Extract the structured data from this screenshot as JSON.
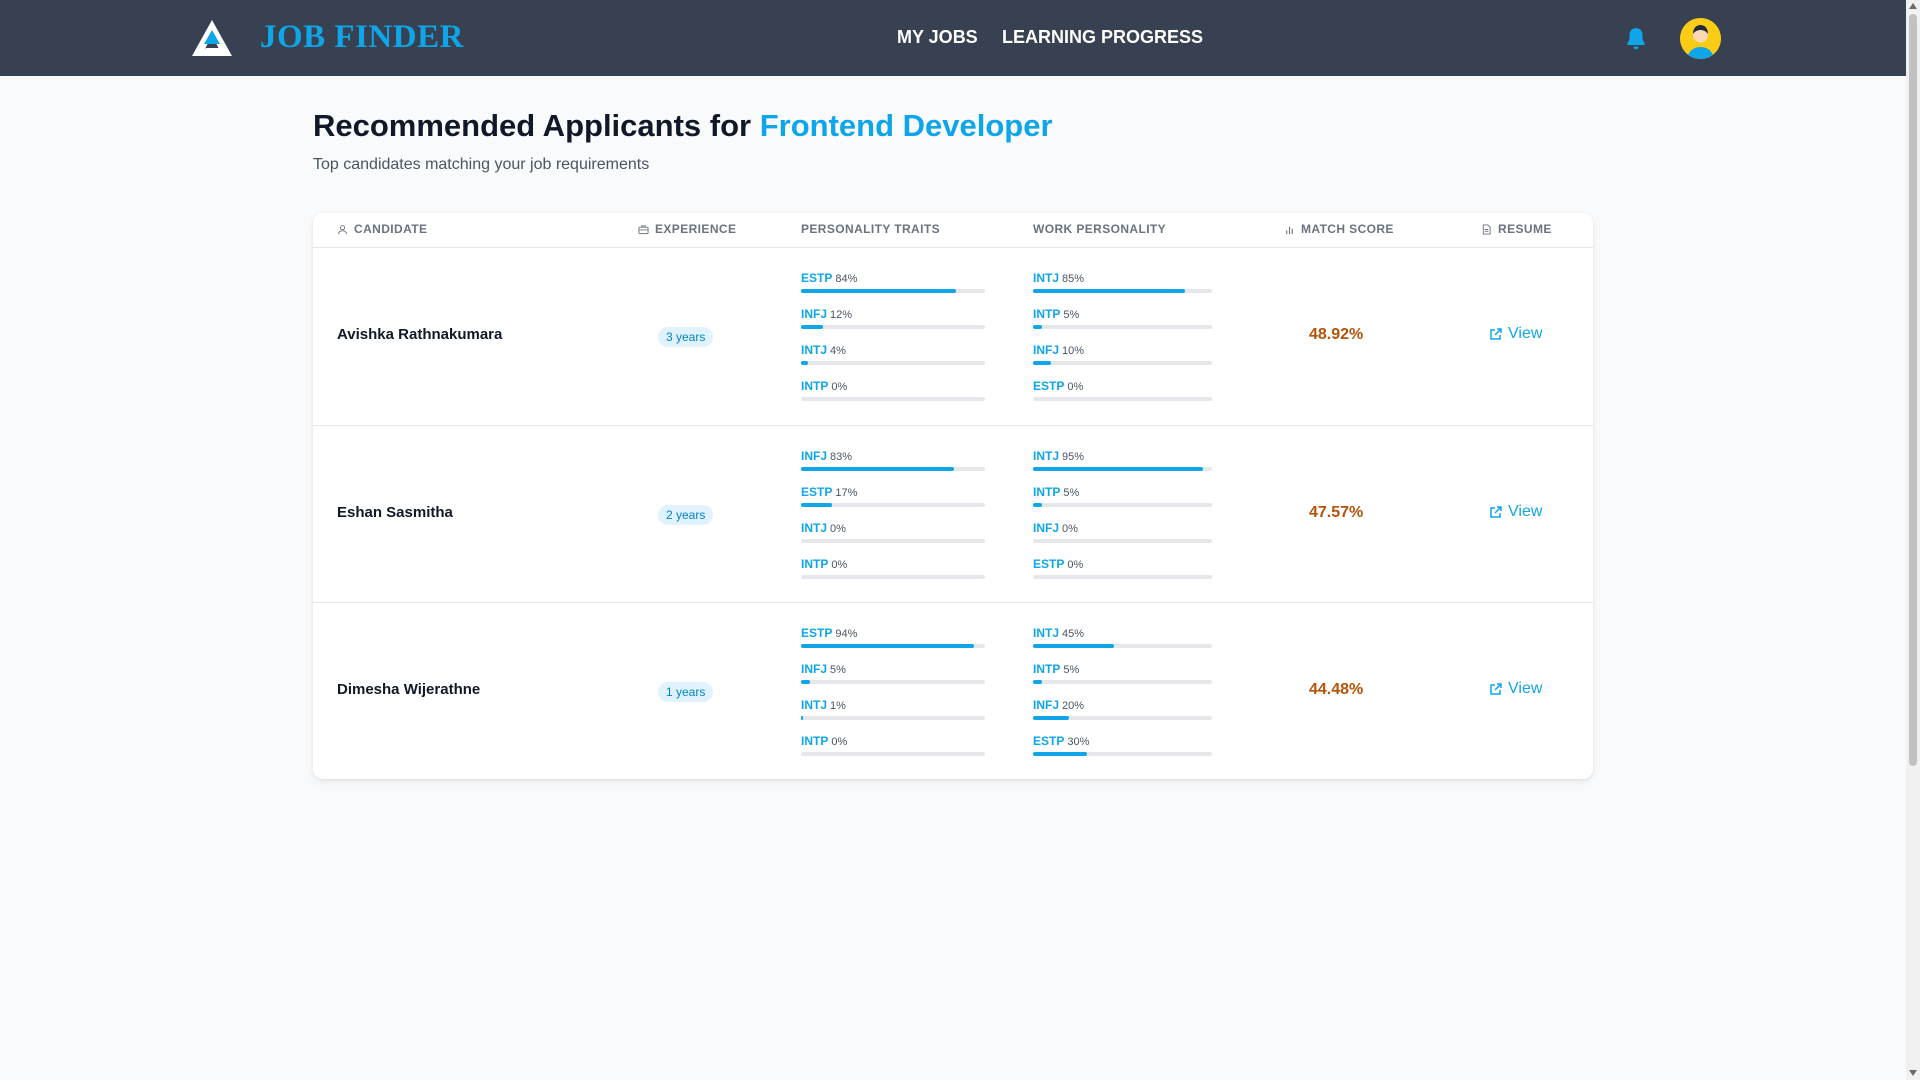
{
  "header": {
    "brand": "JOB FINDER",
    "nav": [
      {
        "label": "MY JOBS"
      },
      {
        "label": "LEARNING PROGRESS"
      }
    ],
    "icons": {
      "logo": "triangle-logo-icon",
      "notifications": "bell-icon",
      "avatar": "user-avatar"
    }
  },
  "page": {
    "title_prefix": "Recommended Applicants for ",
    "job_title": "Frontend Developer",
    "subtitle": "Top candidates matching your job requirements"
  },
  "table": {
    "columns": {
      "candidate": "CANDIDATE",
      "experience": "EXPERIENCE",
      "personality": "PERSONALITY TRAITS",
      "work": "WORK PERSONALITY",
      "score": "MATCH SCORE",
      "resume": "RESUME"
    },
    "rows": [
      {
        "name": "Avishka Rathnakumara",
        "experience": "3 years",
        "personality": [
          {
            "type": "ESTP",
            "pct": "84%",
            "value": 84
          },
          {
            "type": "INFJ",
            "pct": "12%",
            "value": 12
          },
          {
            "type": "INTJ",
            "pct": "4%",
            "value": 4
          },
          {
            "type": "INTP",
            "pct": "0%",
            "value": 0
          }
        ],
        "work": [
          {
            "type": "INTJ",
            "pct": "85%",
            "value": 85
          },
          {
            "type": "INTP",
            "pct": "5%",
            "value": 5
          },
          {
            "type": "INFJ",
            "pct": "10%",
            "value": 10
          },
          {
            "type": "ESTP",
            "pct": "0%",
            "value": 0
          }
        ],
        "score": "48.92%",
        "resume": "View"
      },
      {
        "name": "Eshan Sasmitha",
        "experience": "2 years",
        "personality": [
          {
            "type": "INFJ",
            "pct": "83%",
            "value": 83
          },
          {
            "type": "ESTP",
            "pct": "17%",
            "value": 17
          },
          {
            "type": "INTJ",
            "pct": "0%",
            "value": 0
          },
          {
            "type": "INTP",
            "pct": "0%",
            "value": 0
          }
        ],
        "work": [
          {
            "type": "INTJ",
            "pct": "95%",
            "value": 95
          },
          {
            "type": "INTP",
            "pct": "5%",
            "value": 5
          },
          {
            "type": "INFJ",
            "pct": "0%",
            "value": 0
          },
          {
            "type": "ESTP",
            "pct": "0%",
            "value": 0
          }
        ],
        "score": "47.57%",
        "resume": "View"
      },
      {
        "name": "Dimesha Wijerathne",
        "experience": "1 years",
        "personality": [
          {
            "type": "ESTP",
            "pct": "94%",
            "value": 94
          },
          {
            "type": "INFJ",
            "pct": "5%",
            "value": 5
          },
          {
            "type": "INTJ",
            "pct": "1%",
            "value": 1
          },
          {
            "type": "INTP",
            "pct": "0%",
            "value": 0
          }
        ],
        "work": [
          {
            "type": "INTJ",
            "pct": "45%",
            "value": 45
          },
          {
            "type": "INTP",
            "pct": "5%",
            "value": 5
          },
          {
            "type": "INFJ",
            "pct": "20%",
            "value": 20
          },
          {
            "type": "ESTP",
            "pct": "30%",
            "value": 30
          }
        ],
        "score": "44.48%",
        "resume": "View"
      }
    ]
  },
  "colors": {
    "header_bg": "#374151",
    "accent": "#0ea5e9",
    "score": "#b45309",
    "badge_bg": "#e0f2fe"
  }
}
